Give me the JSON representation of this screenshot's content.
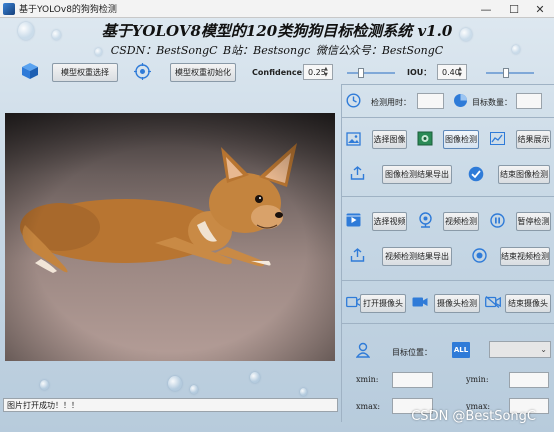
{
  "window": {
    "title": "基于YOLOv8的狗狗检测",
    "minimize": "—",
    "maximize": "☐",
    "close": "✕"
  },
  "header": {
    "title": "基于YOLOV8模型的120类狗狗目标检测系统 v1.0",
    "subtitle": "CSDN：BestSongC   B站：Bestsongc   微信公众号：BestSongC"
  },
  "toolbar": {
    "model_select_label": "模型权重选择",
    "model_init_label": "模型权重初始化",
    "confidence_label": "Confidence:",
    "confidence_value": "0.25",
    "iou_label": "IOU：",
    "iou_value": "0.40",
    "confidence_slider_level": 0.25,
    "iou_slider_level": 0.4
  },
  "stats": {
    "time_label": "检测用时：",
    "time_value": "",
    "count_label": "目标数量：",
    "count_value": ""
  },
  "image_section": {
    "select_image": "选择图像",
    "detect_image": "图像检测",
    "show_result": "结果展示",
    "export_image": "图像检测结果导出",
    "end_image": "结束图像检测"
  },
  "video_section": {
    "select_video": "选择视频",
    "detect_video": "视频检测",
    "pause_detect": "暂停检测",
    "export_video": "视频检测结果导出",
    "end_video": "结束视频检测"
  },
  "camera_section": {
    "open_camera": "打开摄像头",
    "detect_camera": "摄像头检测",
    "end_camera": "结束摄像头"
  },
  "target": {
    "position_label": "目标位置：",
    "all_badge": "ALL",
    "select_value": "",
    "xmin_label": "xmin:",
    "ymin_label": "ymin:",
    "xmax_label": "xmax:",
    "ymax_label": "ymax:",
    "xmin": "",
    "ymin": "",
    "xmax": "",
    "ymax": ""
  },
  "status": {
    "message": "图片打开成功！！！"
  },
  "watermark": "CSDN @BestSongC",
  "colors": {
    "accent_blue": "#2f7bd8",
    "background": "#c9d9e6"
  }
}
